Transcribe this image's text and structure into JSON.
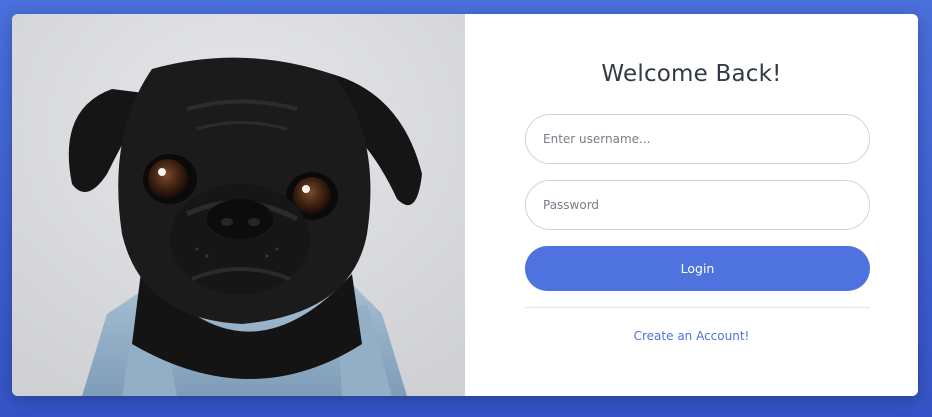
{
  "login_form": {
    "title": "Welcome Back!",
    "username_placeholder": "Enter username...",
    "password_placeholder": "Password",
    "login_label": "Login",
    "create_account_link": "Create an Account!"
  },
  "colors": {
    "background": "#4a70dc",
    "accent": "#4e73df",
    "card": "#ffffff"
  }
}
